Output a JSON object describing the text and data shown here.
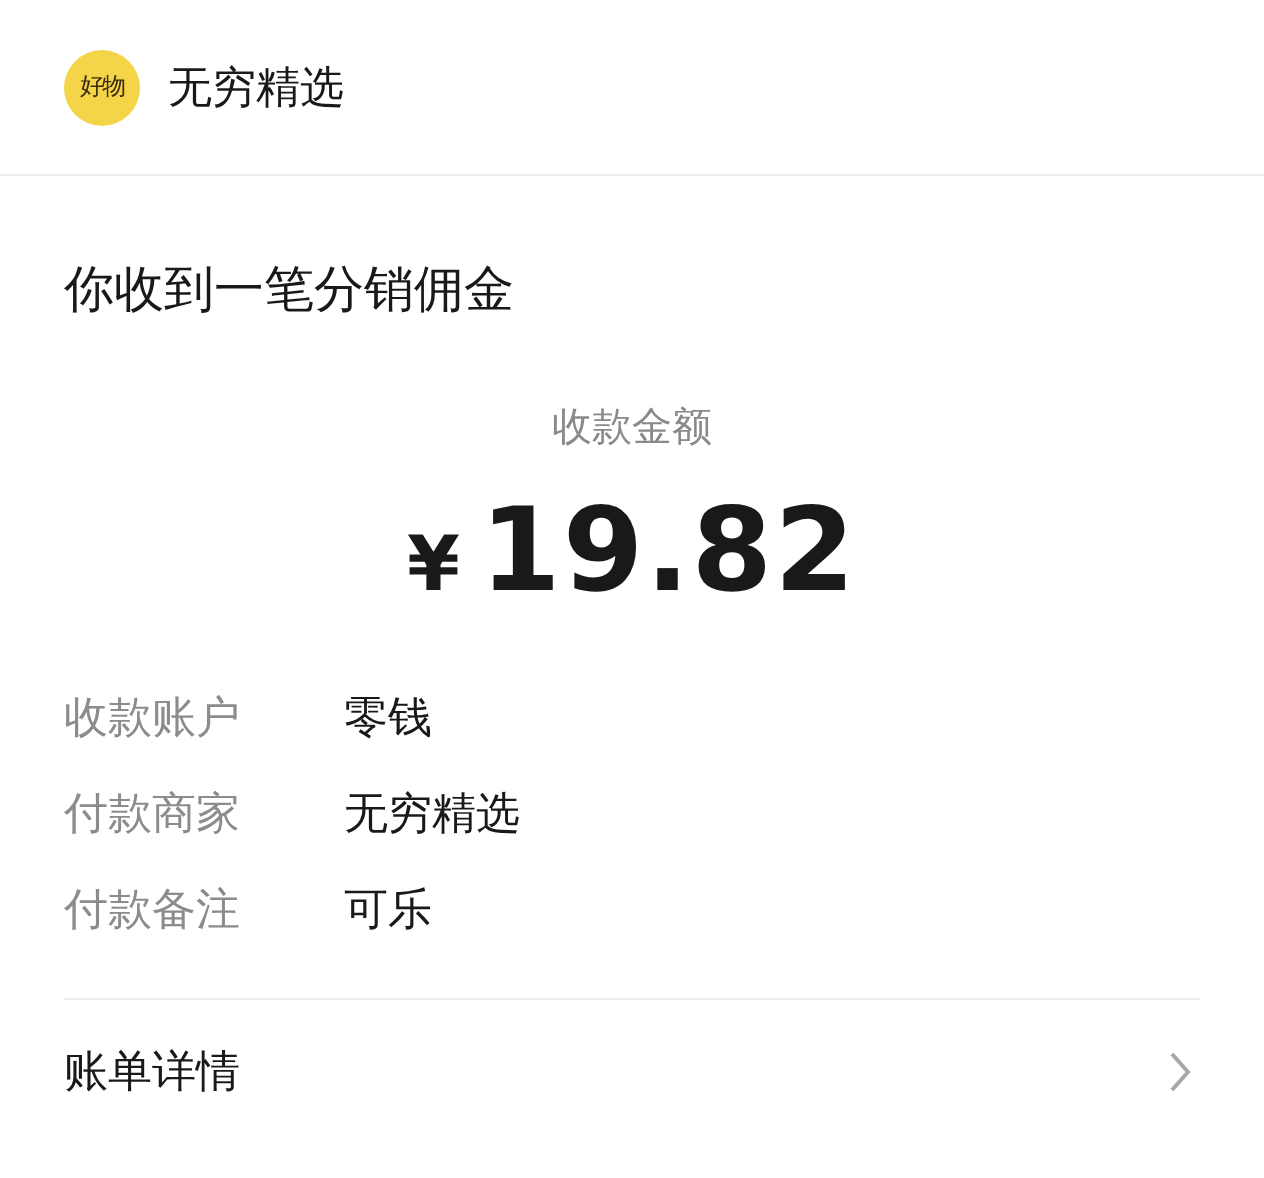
{
  "header": {
    "logo_text": "好物",
    "title": "无穷精选"
  },
  "message": {
    "title": "你收到一笔分销佣金",
    "amount_label": "收款金额",
    "currency": "¥",
    "amount": "19.82"
  },
  "details": [
    {
      "label": "收款账户",
      "value": "零钱"
    },
    {
      "label": "付款商家",
      "value": "无穷精选"
    },
    {
      "label": "付款备注",
      "value": "可乐"
    }
  ],
  "footer_link": {
    "label": "账单详情"
  }
}
